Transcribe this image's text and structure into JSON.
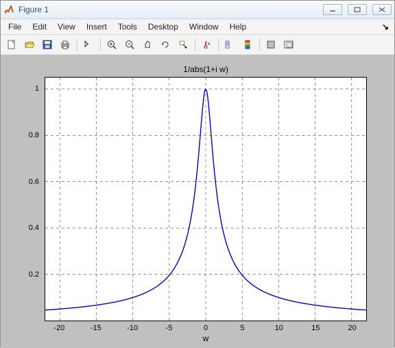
{
  "window": {
    "title": "Figure 1"
  },
  "menu": {
    "file": "File",
    "edit": "Edit",
    "view": "View",
    "insert": "Insert",
    "tools": "Tools",
    "desktop": "Desktop",
    "window": "Window",
    "help": "Help"
  },
  "chart_data": {
    "type": "line",
    "title": "1/abs(1+i w)",
    "xlabel": "w",
    "ylabel": "",
    "xlim": [
      -22,
      22
    ],
    "ylim": [
      0,
      1.05
    ],
    "xticks": [
      -20,
      -15,
      -10,
      -5,
      0,
      5,
      10,
      15,
      20
    ],
    "yticks": [
      0.2,
      0.4,
      0.6,
      0.8,
      1
    ],
    "function": "y = 1 / sqrt(1 + w^2)",
    "sample_values": [
      {
        "w": -20,
        "y": 0.0499
      },
      {
        "w": -15,
        "y": 0.0665
      },
      {
        "w": -10,
        "y": 0.0995
      },
      {
        "w": -5,
        "y": 0.1961
      },
      {
        "w": -2,
        "y": 0.4472
      },
      {
        "w": -1,
        "y": 0.7071
      },
      {
        "w": 0,
        "y": 1.0
      },
      {
        "w": 1,
        "y": 0.7071
      },
      {
        "w": 2,
        "y": 0.4472
      },
      {
        "w": 5,
        "y": 0.1961
      },
      {
        "w": 10,
        "y": 0.0995
      },
      {
        "w": 15,
        "y": 0.0665
      },
      {
        "w": 20,
        "y": 0.0499
      }
    ]
  }
}
